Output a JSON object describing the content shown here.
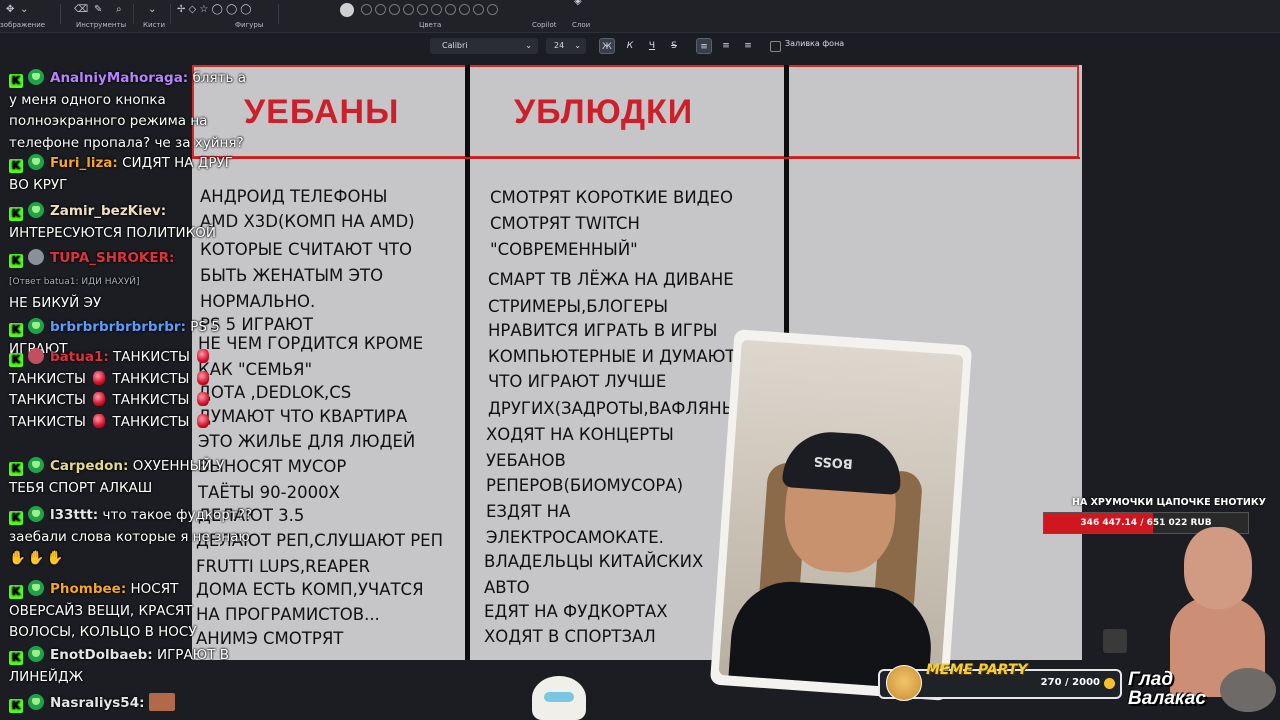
{
  "ribbon": {
    "groups": [
      {
        "label": "зображение"
      },
      {
        "label": "Инструменты"
      },
      {
        "label": "Кисти"
      },
      {
        "label": "Фигуры"
      },
      {
        "label": "Цвета"
      },
      {
        "label": "Copilot"
      },
      {
        "label": "Слои"
      }
    ]
  },
  "format_bar": {
    "font": "Calibri",
    "size": "24",
    "bold": "Ж",
    "italic": "К",
    "underline": "Ч",
    "strike": "S",
    "fill_label": "Заливка фона"
  },
  "board": {
    "headers": [
      "УЕБАНЫ",
      "УБЛЮДКИ",
      ""
    ],
    "col1": [
      "АНДРОИД ТЕЛЕФОНЫ",
      "AMD X3D(КОМП НА AMD)",
      "КОТОРЫЕ СЧИТАЮТ ЧТО",
      "БЫТЬ ЖЕНАТЫМ ЭТО",
      "НОРМАЛЬНО.",
      "PS 5 ИГРАЮТ",
      "НЕ ЧЕМ ГОРДИТСЯ КРОМЕ",
      "КАК \"СЕМЬЯ\"",
      "ДОТА ,DEDLOK,CS",
      "ДУМАЮТ ЧТО КВАРТИРА",
      "ЭТО ЖИЛЬЕ ДЛЯ ЛЮДЕЙ",
      "ВЫНОСЯТ МУСОР",
      "ТАЁТЫ 90-2000Х",
      "ДЕЛАЮТ 3.5",
      "ДЕЛАЮТ РЕП,СЛУШАЮТ РЕП",
      "FRUTTI LUPS,REAPER",
      "ДОМА ЕСТЬ КОМП,УЧАТСЯ",
      "НА ПРОГРАМИСТОВ...",
      "АНИМЭ СМОТРЯТ"
    ],
    "col2": [
      "СМОТРЯТ КОРОТКИЕ ВИДЕО",
      "СМОТРЯТ TWITCH",
      "\"СОВРЕМЕННЫЙ\"",
      "СМАРТ ТВ ЛЁЖА НА ДИВАНЕ",
      "СТРИМЕРЫ,БЛОГЕРЫ",
      "НРАВИТСЯ ИГРАТЬ В ИГРЫ",
      "КОМПЬЮТЕРНЫЕ И ДУМАЮТ",
      "ЧТО ИГРАЮТ ЛУЧШЕ",
      "ДРУГИХ(ЗАДРОТЫ,ВАФЛЯНЬ",
      "ХОДЯТ НА КОНЦЕРТЫ",
      "УЕБАНОВ",
      "РЕПЕРОВ(БИОМУСОРА)",
      "ЕЗДЯТ НА",
      "ЭЛЕКТРОСАМОКАТЕ.",
      "ВЛАДЕЛЬЦЫ КИТАЙСКИХ",
      "АВТО",
      "ЕДЯТ НА ФУДКОРТАХ",
      "ХОДЯТ В СПОРТЗАЛ"
    ]
  },
  "chat": [
    {
      "user": "AnalniyMahoraga:",
      "color": "#b583ff",
      "text": "блять а у меня одного кнопка полноэкранного режима на телефоне пропала? че за хуйня?"
    },
    {
      "user": "Furi_liza:",
      "color": "#f5a623",
      "text": "СИДЯТ НА ДРУГ ВО КРУГ"
    },
    {
      "user": "Zamir_bezKiev:",
      "color": "#f0e0c0",
      "text": "ИНТЕРЕСУЮТСЯ ПОЛИТИКОЙ"
    },
    {
      "user": "TUPA_SHROKER:",
      "color": "#e0323c",
      "reply": "[Ответ batua1: ИДИ НАХУЙ]",
      "text": "НЕ БИКУЙ ЭУ"
    },
    {
      "user": "brbrbrbrbrbrbrbr:",
      "color": "#5b9cff",
      "text": "PS 5 ИГРАЮТ"
    },
    {
      "user": "batua1:",
      "color": "#e0323c",
      "text": "ТАНКИСТЫ"
    },
    {
      "user": "Carpedon:",
      "color": "#e6d88a",
      "text": "ОХУЕННЫЙ У ТЕБЯ СПОРТ АЛКАШ"
    },
    {
      "user": "l33ttt:",
      "color": "#e6e6e6",
      "text": "что такое фудкорт?? заебали слова которые я не знаю"
    },
    {
      "user": "Phombee:",
      "color": "#f5a623",
      "text": "НОСЯТ ОВЕРСАЙЗ ВЕЩИ, КРАСЯТ ВОЛОСЫ, КОЛЬЦО В НОСУ"
    },
    {
      "user": "EnotDolbaeb:",
      "color": "#e6e6e6",
      "text": "ИГРАЮТ В ЛИНЕЙДЖ"
    },
    {
      "user": "Nasraliys54:",
      "color": "#e6e6e6",
      "text": ""
    }
  ],
  "webcam": {
    "cap_text": "BOSS"
  },
  "goal": {
    "title": "НА ХРУМОЧКИ ЦАПОЧКЕ ЕНОТИКУ",
    "amount": "346 447.14 / 651 022 RUB",
    "progress": 0.532
  },
  "meme_party": {
    "label": "MEME PARTY",
    "count": "270 / 2000",
    "progress": 0.135
  },
  "streamer": {
    "name": "Глад Валакас"
  }
}
